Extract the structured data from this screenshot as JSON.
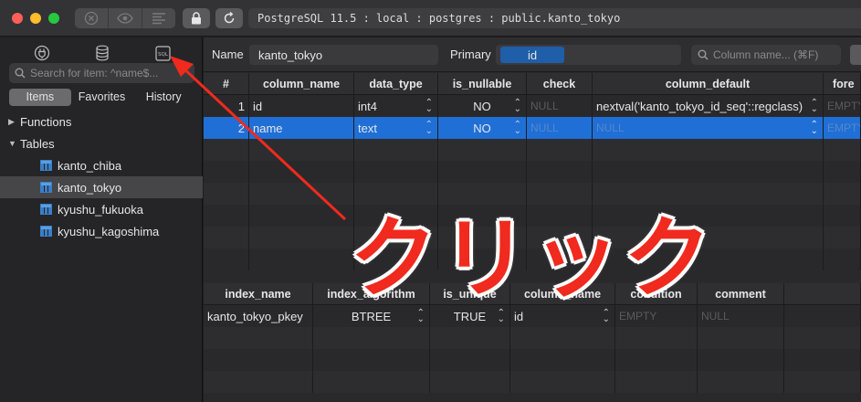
{
  "titlebar": {
    "connection": "PostgreSQL 11.5 : local : postgres : public.kanto_tokyo"
  },
  "sidebar": {
    "search_placeholder": "Search for item: ^name$...",
    "tabs": [
      "Items",
      "Favorites",
      "History"
    ],
    "active_tab": "Items",
    "groups": {
      "functions": "Functions",
      "tables": "Tables"
    },
    "tables": [
      "kanto_chiba",
      "kanto_tokyo",
      "kyushu_fukuoka",
      "kyushu_kagoshima"
    ],
    "selected_table": "kanto_tokyo"
  },
  "structure": {
    "name_label": "Name",
    "name_value": "kanto_tokyo",
    "primary_label": "Primary",
    "primary_value": "id",
    "column_search_placeholder": "Column name... (⌘F)",
    "columns_headers": [
      "#",
      "column_name",
      "data_type",
      "is_nullable",
      "check",
      "column_default",
      "fore"
    ],
    "columns_rows": [
      {
        "num": "1",
        "column_name": "id",
        "data_type": "int4",
        "is_nullable": "NO",
        "check": "NULL",
        "column_default": "nextval('kanto_tokyo_id_seq'::regclass)",
        "fore": "EMPTY"
      },
      {
        "num": "2",
        "column_name": "name",
        "data_type": "text",
        "is_nullable": "NO",
        "check": "NULL",
        "column_default": "NULL",
        "fore": "EMPTY"
      }
    ],
    "index_headers": [
      "index_name",
      "index_algorithm",
      "is_unique",
      "column_name",
      "condition",
      "comment"
    ],
    "index_rows": [
      {
        "index_name": "kanto_tokyo_pkey",
        "index_algorithm": "BTREE",
        "is_unique": "TRUE",
        "column_name": "id",
        "condition": "EMPTY",
        "comment": "NULL"
      }
    ]
  },
  "annotation": {
    "text": "クリック",
    "color": "#f02a1e"
  },
  "colors": {
    "selection": "#1f6fd6",
    "primary_badge": "#1f5ea8"
  }
}
